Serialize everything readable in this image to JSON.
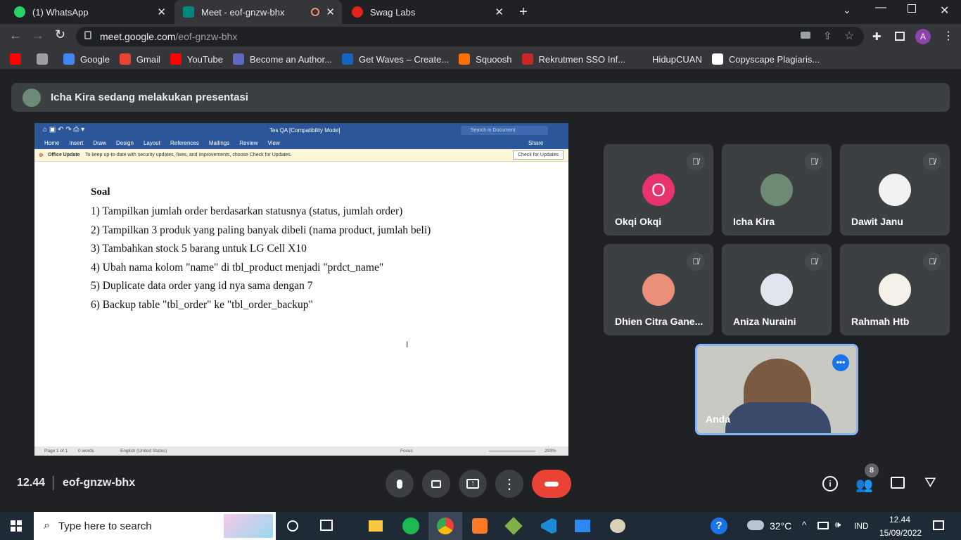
{
  "tabs": [
    {
      "label": "(1) WhatsApp",
      "icon": "whatsapp-icon",
      "color": "#25d366"
    },
    {
      "label": "Meet - eof-gnzw-bhx",
      "icon": "meet-icon",
      "color": "#00897b"
    },
    {
      "label": "Swag Labs",
      "icon": "swaglabs-icon",
      "color": "#e2231a"
    }
  ],
  "url": {
    "host": "meet.google.com",
    "path": "/eof-gnzw-bhx"
  },
  "profile": "A",
  "bookmarks": [
    {
      "label": "",
      "color": "#ff0000"
    },
    {
      "label": "",
      "color": "#9e9e9e"
    },
    {
      "label": "Google",
      "color": "#4285f4"
    },
    {
      "label": "Gmail",
      "color": "#ea4335"
    },
    {
      "label": "YouTube",
      "color": "#ff0000"
    },
    {
      "label": "Become an Author...",
      "color": "#5c6bc0"
    },
    {
      "label": "Get Waves – Create...",
      "color": "#1565c0"
    },
    {
      "label": "Squoosh",
      "color": "#ff6f00"
    },
    {
      "label": "Rekrutmen SSO Inf...",
      "color": "#c62828"
    },
    {
      "label": "HidupCUAN",
      "color": "#35363a"
    },
    {
      "label": "Copyscape Plagiaris...",
      "color": "#ffffff"
    }
  ],
  "banner": "Icha Kira sedang melakukan presentasi",
  "doc": {
    "title": "Tes QA [Compatibility Mode]",
    "search_placeholder": "Search in Document",
    "share": "Share",
    "menu": [
      "Home",
      "Insert",
      "Draw",
      "Design",
      "Layout",
      "References",
      "Mailings",
      "Review",
      "View"
    ],
    "update_label": "Office Update",
    "update_text": "To keep up-to-date with security updates, fixes, and improvements, choose Check for Updates.",
    "update_button": "Check for Updates",
    "heading": "Soal",
    "lines": [
      "1) Tampilkan jumlah order berdasarkan statusnya (status, jumlah order)",
      "2) Tampilkan 3 produk yang paling banyak dibeli (nama product, jumlah beli)",
      "3) Tambahkan stock 5 barang untuk LG Cell X10",
      "4) Ubah nama kolom \"name\" di tbl_product menjadi \"prdct_name\"",
      "5) Duplicate data order yang id nya sama dengan 7",
      "6) Backup table \"tbl_order\" ke \"tbl_order_backup\""
    ],
    "status_page": "Page 1 of 1",
    "status_words": "0 words",
    "status_lang": "English (United States)",
    "status_focus": "Focus",
    "zoom": "293%"
  },
  "participants": [
    {
      "name": "Okqi Okqi",
      "initial": "O",
      "color": "#e8336d"
    },
    {
      "name": "Icha Kira",
      "initial": "",
      "color": "#6d8b74"
    },
    {
      "name": "Dawit Janu",
      "initial": "",
      "color": "#f1f1f1"
    },
    {
      "name": "Dhien Citra Gane...",
      "initial": "",
      "color": "#e98f7a"
    },
    {
      "name": "Aniza Nuraini",
      "initial": "",
      "color": "#dfe6ee"
    },
    {
      "name": "Rahmah Htb",
      "initial": "",
      "color": "#f5f1e8"
    }
  ],
  "self": {
    "name": "Anda"
  },
  "meeting": {
    "time": "12.44",
    "code": "eof-gnzw-bhx",
    "participant_count": "8"
  },
  "taskbar": {
    "search_placeholder": "Type here to search",
    "weather": "32°C",
    "lang": "IND",
    "time": "12.44",
    "date": "15/09/2022"
  }
}
